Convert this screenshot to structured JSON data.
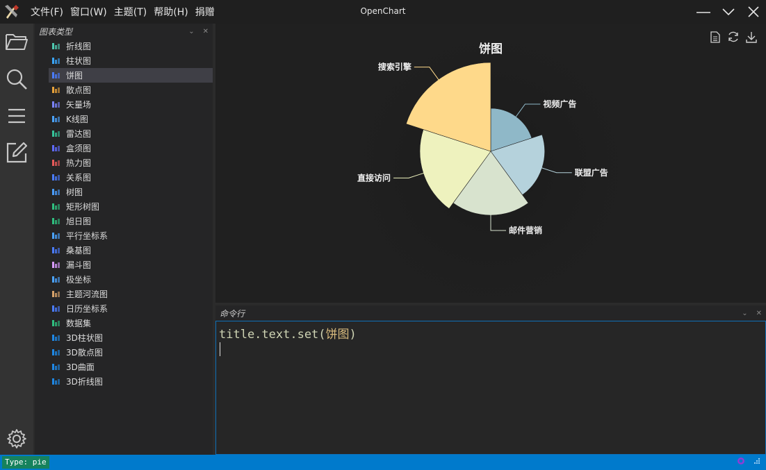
{
  "window": {
    "title": "OpenChart",
    "menu": [
      "文件(F)",
      "窗口(W)",
      "主题(T)",
      "帮助(H)",
      "捐赠"
    ]
  },
  "left_panel": {
    "title": "图表类型",
    "selected_index": 2,
    "items": [
      {
        "label": "折线图",
        "icon": "line-chart-icon",
        "color": "#4ec9b0"
      },
      {
        "label": "柱状图",
        "icon": "bar-chart-icon",
        "color": "#3aa6ff"
      },
      {
        "label": "饼图",
        "icon": "pie-chart-icon",
        "color": "#4a7cff"
      },
      {
        "label": "散点图",
        "icon": "scatter-chart-icon",
        "color": "#e8a23a"
      },
      {
        "label": "矢量场",
        "icon": "vector-field-icon",
        "color": "#7b83ff"
      },
      {
        "label": "K线图",
        "icon": "candlestick-icon",
        "color": "#4aa3ff"
      },
      {
        "label": "雷达图",
        "icon": "radar-chart-icon",
        "color": "#35c49a"
      },
      {
        "label": "盒须图",
        "icon": "boxplot-icon",
        "color": "#5f6bff"
      },
      {
        "label": "热力图",
        "icon": "heatmap-icon",
        "color": "#e85a5a"
      },
      {
        "label": "关系图",
        "icon": "graph-icon",
        "color": "#4a7cff"
      },
      {
        "label": "树图",
        "icon": "tree-icon",
        "color": "#4a9dff"
      },
      {
        "label": "矩形树图",
        "icon": "treemap-icon",
        "color": "#2fbf7f"
      },
      {
        "label": "旭日图",
        "icon": "sunburst-icon",
        "color": "#2fbf7f"
      },
      {
        "label": "平行坐标系",
        "icon": "parallel-icon",
        "color": "#4aa3ff"
      },
      {
        "label": "桑基图",
        "icon": "sankey-icon",
        "color": "#4a7cff"
      },
      {
        "label": "漏斗图",
        "icon": "funnel-icon",
        "color": "#d89bff"
      },
      {
        "label": "极坐标",
        "icon": "polar-icon",
        "color": "#4aa3ff"
      },
      {
        "label": "主题河流图",
        "icon": "theme-river-icon",
        "color": "#d8a36a"
      },
      {
        "label": "日历坐标系",
        "icon": "calendar-icon",
        "color": "#4a7cff"
      },
      {
        "label": "数据集",
        "icon": "dataset-icon",
        "color": "#2fbf7f"
      },
      {
        "label": "3D柱状图",
        "icon": "3d-bar-icon",
        "color": "#1e88e5"
      },
      {
        "label": "3D散点图",
        "icon": "3d-scatter-icon",
        "color": "#1e88e5"
      },
      {
        "label": "3D曲面",
        "icon": "3d-surface-icon",
        "color": "#1e88e5"
      },
      {
        "label": "3D折线图",
        "icon": "3d-line-icon",
        "color": "#1e88e5"
      }
    ]
  },
  "command_panel": {
    "title": "命令行",
    "line_prefix": "title.text.set(",
    "line_arg": "饼图",
    "line_suffix": ")"
  },
  "status": {
    "type_text": "Type: pie"
  },
  "chart_data": {
    "type": "pie",
    "title": "饼图",
    "rose_type": "radius",
    "slices": [
      {
        "name": "视频广告",
        "value": 235,
        "color": "#8fb8c8"
      },
      {
        "name": "联盟广告",
        "value": 274,
        "color": "#b5d2dc"
      },
      {
        "name": "邮件营销",
        "value": 310,
        "color": "#d8e3ce"
      },
      {
        "name": "直接访问",
        "value": 335,
        "color": "#eef2be"
      },
      {
        "name": "搜索引擎",
        "value": 400,
        "color": "#fed98a"
      }
    ]
  }
}
